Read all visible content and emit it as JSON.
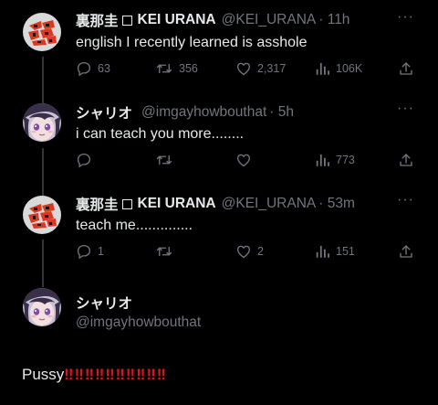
{
  "tweets": [
    {
      "name": "裏那圭",
      "display_name": "KEI URANA",
      "handle": "@KEI_URANA",
      "time": "· 11h",
      "text": "english I recently learned is asshole",
      "replies": "63",
      "retweets": "356",
      "likes": "2,317",
      "views": "106K"
    },
    {
      "name": "シャリオ",
      "handle": "@imgayhowbouthat",
      "time": "· 5h",
      "text": "i can teach you more........",
      "replies": "",
      "retweets": "",
      "likes": "",
      "views": "773"
    },
    {
      "name": "裏那圭",
      "display_name": "KEI URANA",
      "handle": "@KEI_URANA",
      "time": "· 53m",
      "text": "teach me..............",
      "replies": "1",
      "retweets": "",
      "likes": "2",
      "views": "151"
    }
  ],
  "compose": {
    "name": "シャリオ",
    "handle": "@imgayhowbouthat",
    "text": "Pussy",
    "emoji": "‼️‼️‼️‼️‼️‼️‼️‼️‼️‼️",
    "emoji_display": "‼‼‼‼‼‼‼‼‼‼"
  },
  "icons": {
    "reply": "reply-icon",
    "retweet": "retweet-icon",
    "like": "like-icon",
    "views": "views-icon",
    "share": "share-icon",
    "more": "more-icon"
  },
  "colors": {
    "background": "#000000",
    "text": "#e7e9ea",
    "muted": "#71767b",
    "thread_line": "#333639",
    "kei_avatar_bg": "#d9d9d9",
    "kei_avatar_logo": "#d8391f",
    "emoji_red": "#e0121d"
  },
  "more_label": "···"
}
